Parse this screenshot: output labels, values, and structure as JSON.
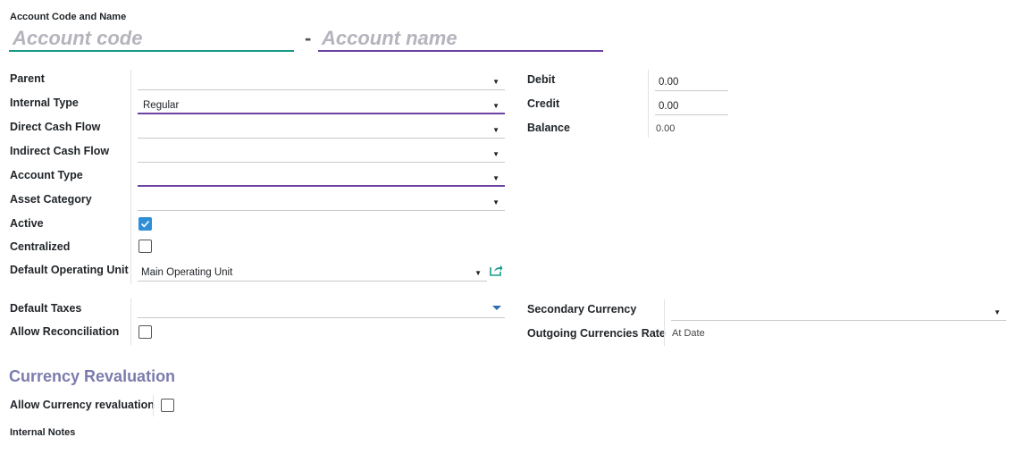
{
  "header": {
    "code_name_label": "Account Code and Name",
    "code_placeholder": "Account code",
    "name_placeholder": "Account name",
    "dash": "-"
  },
  "left_fields": [
    {
      "label": "Parent",
      "value": ""
    },
    {
      "label": "Internal Type",
      "value": "Regular"
    },
    {
      "label": "Direct Cash Flow",
      "value": ""
    },
    {
      "label": "Indirect Cash Flow",
      "value": ""
    },
    {
      "label": "Account Type",
      "value": ""
    },
    {
      "label": "Asset Category",
      "value": ""
    }
  ],
  "active": {
    "label": "Active",
    "checked": true
  },
  "centralized": {
    "label": "Centralized",
    "checked": false
  },
  "operating_unit": {
    "label": "Default Operating Unit",
    "value": "Main Operating Unit"
  },
  "right": {
    "debit_label": "Debit",
    "debit": "0.00",
    "credit_label": "Credit",
    "credit": "0.00",
    "balance_label": "Balance",
    "balance": "0.00"
  },
  "default_taxes": {
    "label": "Default Taxes",
    "value": ""
  },
  "allow_reconciliation": {
    "label": "Allow Reconciliation",
    "checked": false
  },
  "secondary_currency": {
    "label": "Secondary Currency",
    "value": ""
  },
  "outgoing_rate": {
    "label": "Outgoing Currencies Rate",
    "value": "At Date"
  },
  "currency_revaluation": {
    "title": "Currency Revaluation",
    "allow_label": "Allow Currency revaluation",
    "checked": false
  },
  "notes": {
    "label": "Internal Notes"
  },
  "colors": {
    "accent": "#6f42a0",
    "teal": "#1a9b8a",
    "check": "#2f8ed8",
    "section": "#7c7bad"
  }
}
